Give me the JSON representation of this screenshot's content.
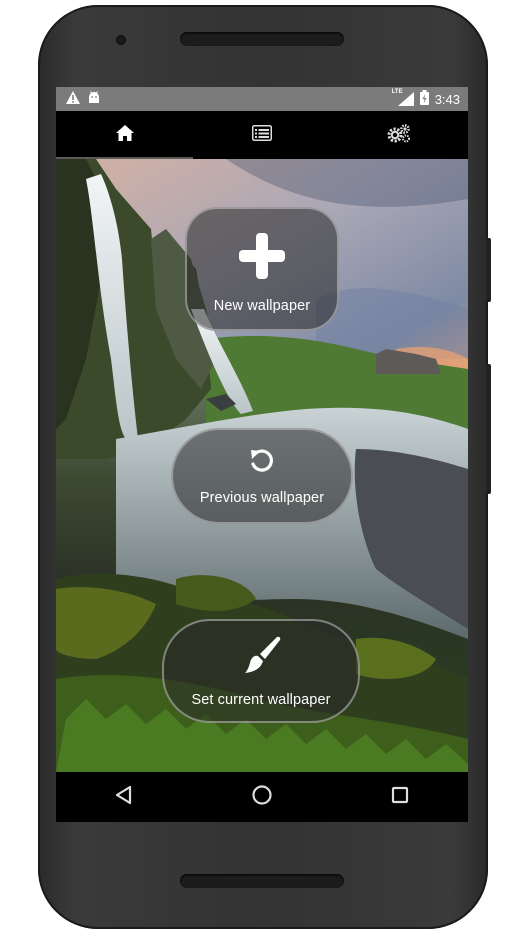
{
  "status_bar": {
    "time": "3:43",
    "network": "LTE",
    "left_icons": [
      "warning-icon",
      "android-debug-icon"
    ],
    "right_icons": [
      "signal-icon",
      "battery-icon"
    ]
  },
  "tabs": [
    {
      "icon": "home-icon",
      "active": true
    },
    {
      "icon": "list-icon",
      "active": false
    },
    {
      "icon": "settings-gears-icon",
      "active": false
    }
  ],
  "actions": {
    "new_wallpaper": {
      "label": "New wallpaper",
      "icon": "plus-icon"
    },
    "previous_wallpaper": {
      "label": "Previous wallpaper",
      "icon": "undo-icon"
    },
    "set_current_wallpaper": {
      "label": "Set current wallpaper",
      "icon": "paintbrush-icon"
    }
  },
  "nav_bar": {
    "icons": [
      "back-icon",
      "home-circle-icon",
      "recents-icon"
    ]
  }
}
